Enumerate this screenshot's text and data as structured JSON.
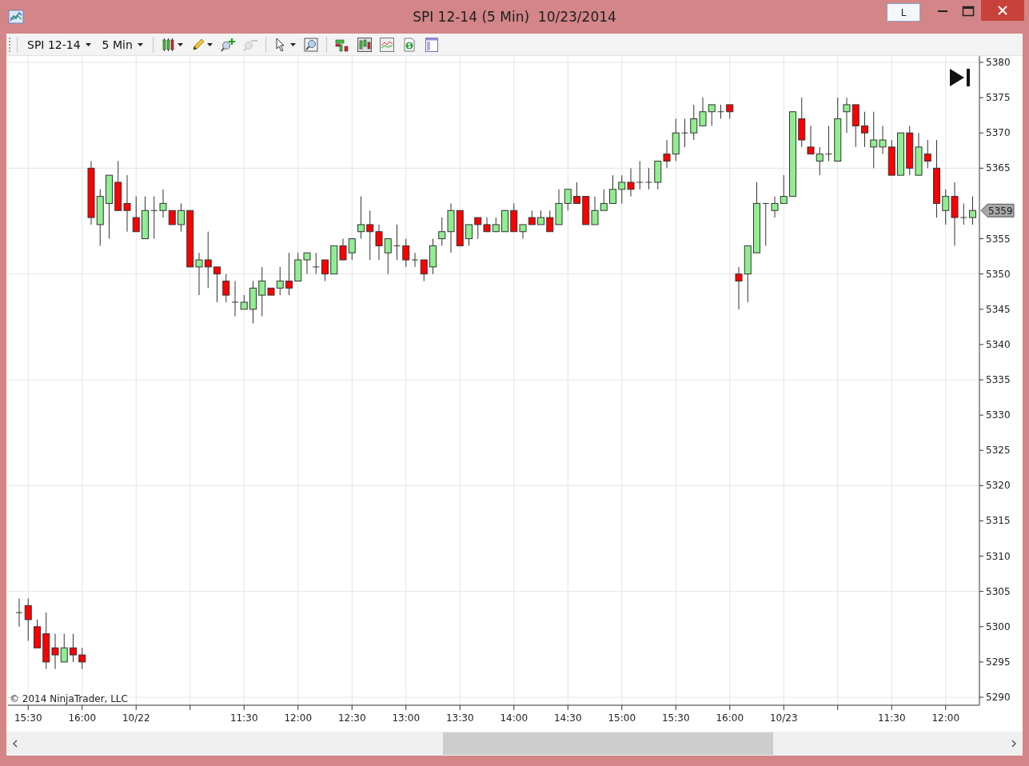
{
  "window": {
    "title": "SPI 12-14 (5 Min)  10/23/2014",
    "link_button": "L"
  },
  "toolbar": {
    "items": [
      {
        "kind": "grip"
      },
      {
        "kind": "separator"
      },
      {
        "kind": "menu",
        "label": "SPI 12-14"
      },
      {
        "kind": "menu",
        "label": "5 Min"
      },
      {
        "kind": "separator"
      },
      {
        "kind": "style",
        "dropdown": true,
        "disabled": false
      },
      {
        "kind": "draw",
        "dropdown": true,
        "disabled": false
      },
      {
        "kind": "zoomin",
        "dropdown": false,
        "disabled": false
      },
      {
        "kind": "zoomout",
        "dropdown": false,
        "disabled": true
      },
      {
        "kind": "separator"
      },
      {
        "kind": "cursor",
        "dropdown": true,
        "disabled": false
      },
      {
        "kind": "magnify",
        "dropdown": false,
        "disabled": false
      },
      {
        "kind": "separator"
      },
      {
        "kind": "indicators",
        "dropdown": false,
        "disabled": false
      },
      {
        "kind": "bars",
        "dropdown": false,
        "disabled": false
      },
      {
        "kind": "panels",
        "dropdown": false,
        "disabled": false
      },
      {
        "kind": "money",
        "dropdown": false,
        "disabled": false
      },
      {
        "kind": "properties",
        "dropdown": false,
        "disabled": false
      }
    ]
  },
  "chart": {
    "copyright": "© 2014 NinjaTrader, LLC",
    "chart_data": {
      "type": "candlestick",
      "ylim": [
        5290,
        5380
      ],
      "yticks": [
        5290,
        5295,
        5300,
        5305,
        5310,
        5315,
        5320,
        5325,
        5330,
        5335,
        5340,
        5345,
        5350,
        5355,
        5365,
        5370,
        5375,
        5380
      ],
      "categories": [
        null,
        "15:30",
        null,
        null,
        null,
        null,
        null,
        "16:00",
        null,
        null,
        null,
        null,
        null,
        "10/22",
        null,
        null,
        null,
        null,
        null,
        null,
        null,
        null,
        null,
        null,
        null,
        "11:30",
        null,
        null,
        null,
        null,
        null,
        "12:00",
        null,
        null,
        null,
        null,
        null,
        "12:30",
        null,
        null,
        null,
        null,
        null,
        "13:00",
        null,
        null,
        null,
        null,
        null,
        "13:30",
        null,
        null,
        null,
        null,
        null,
        "14:00",
        null,
        null,
        null,
        null,
        null,
        "14:30",
        null,
        null,
        null,
        null,
        null,
        "15:00",
        null,
        null,
        null,
        null,
        null,
        "15:30",
        null,
        null,
        null,
        null,
        null,
        "16:00",
        null,
        null,
        null,
        null,
        null,
        "10/23",
        null,
        null,
        null,
        null,
        null,
        null,
        null,
        null,
        null,
        null,
        null,
        "11:30",
        null,
        null,
        null,
        null,
        null,
        "12:00",
        null,
        null,
        null
      ],
      "annotations": [
        "5359"
      ],
      "grid": true,
      "ohlc": [
        [
          5302,
          5304,
          5300,
          5302
        ],
        [
          5303,
          5304,
          5298,
          5301
        ],
        [
          5300,
          5301,
          5297,
          5297
        ],
        [
          5299,
          5302,
          5294,
          5295
        ],
        [
          5297,
          5299,
          5294,
          5296
        ],
        [
          5295,
          5299,
          5295,
          5297
        ],
        [
          5297,
          5299,
          5295,
          5296
        ],
        [
          5296,
          5297,
          5294,
          5295
        ],
        [
          5365,
          5366,
          5357,
          5358
        ],
        [
          5357,
          5362,
          5354,
          5361
        ],
        [
          5360,
          5364,
          5355,
          5364
        ],
        [
          5363,
          5366,
          5359,
          5359
        ],
        [
          5360,
          5364,
          5356,
          5359
        ],
        [
          5358,
          5361,
          5356,
          5356
        ],
        [
          5355,
          5361,
          5355,
          5359
        ],
        [
          5359,
          5361,
          5355,
          5359
        ],
        [
          5359,
          5362,
          5358,
          5360
        ],
        [
          5359,
          5359,
          5357,
          5357
        ],
        [
          5357,
          5360,
          5356,
          5359
        ],
        [
          5359,
          5359,
          5351,
          5351
        ],
        [
          5351,
          5353,
          5347,
          5352
        ],
        [
          5352,
          5356,
          5348,
          5351
        ],
        [
          5351,
          5351,
          5346,
          5350
        ],
        [
          5349,
          5350,
          5346,
          5347
        ],
        [
          5346,
          5349,
          5344,
          5346
        ],
        [
          5345,
          5347,
          5345,
          5346
        ],
        [
          5345,
          5349,
          5343,
          5348
        ],
        [
          5347,
          5351,
          5344,
          5349
        ],
        [
          5348,
          5348,
          5347,
          5347
        ],
        [
          5348,
          5351,
          5347,
          5349
        ],
        [
          5349,
          5353,
          5347,
          5348
        ],
        [
          5349,
          5353,
          5349,
          5352
        ],
        [
          5352,
          5353,
          5350,
          5353
        ],
        [
          5351,
          5353,
          5350,
          5351
        ],
        [
          5352,
          5352,
          5349,
          5350
        ],
        [
          5350,
          5354,
          5350,
          5354
        ],
        [
          5354,
          5355,
          5352,
          5352
        ],
        [
          5353,
          5355,
          5352,
          5355
        ],
        [
          5356,
          5361,
          5355,
          5357
        ],
        [
          5357,
          5359,
          5352,
          5356
        ],
        [
          5356,
          5357,
          5352,
          5354
        ],
        [
          5353,
          5355,
          5350,
          5355
        ],
        [
          5354,
          5357,
          5352,
          5354
        ],
        [
          5354,
          5355,
          5351,
          5352
        ],
        [
          5352,
          5353,
          5351,
          5352
        ],
        [
          5352,
          5352,
          5349,
          5350
        ],
        [
          5351,
          5355,
          5350,
          5354
        ],
        [
          5355,
          5358,
          5354,
          5356
        ],
        [
          5356,
          5360,
          5353,
          5359
        ],
        [
          5359,
          5359,
          5354,
          5354
        ],
        [
          5355,
          5357,
          5354,
          5357
        ],
        [
          5358,
          5358,
          5355,
          5357
        ],
        [
          5357,
          5358,
          5356,
          5356
        ],
        [
          5356,
          5358,
          5356,
          5357
        ],
        [
          5356,
          5359,
          5356,
          5359
        ],
        [
          5359,
          5360,
          5356,
          5356
        ],
        [
          5356,
          5357,
          5355,
          5357
        ],
        [
          5358,
          5359,
          5357,
          5357
        ],
        [
          5357,
          5359,
          5357,
          5358
        ],
        [
          5358,
          5359,
          5356,
          5356
        ],
        [
          5357,
          5362,
          5357,
          5360
        ],
        [
          5360,
          5362,
          5359,
          5362
        ],
        [
          5361,
          5363,
          5360,
          5360
        ],
        [
          5361,
          5361,
          5357,
          5357
        ],
        [
          5357,
          5361,
          5357,
          5359
        ],
        [
          5359,
          5362,
          5359,
          5360
        ],
        [
          5360,
          5364,
          5360,
          5362
        ],
        [
          5362,
          5364,
          5360,
          5363
        ],
        [
          5363,
          5365,
          5361,
          5362
        ],
        [
          5363,
          5366,
          5362,
          5363
        ],
        [
          5363,
          5365,
          5362,
          5363
        ],
        [
          5363,
          5366,
          5362,
          5366
        ],
        [
          5367,
          5369,
          5365,
          5366
        ],
        [
          5367,
          5372,
          5366,
          5370
        ],
        [
          5370,
          5372,
          5368,
          5370
        ],
        [
          5370,
          5374,
          5369,
          5372
        ],
        [
          5371,
          5375,
          5371,
          5373
        ],
        [
          5373,
          5374,
          5371,
          5374
        ],
        [
          5373,
          5374,
          5372,
          5373
        ],
        [
          5374,
          5374,
          5372,
          5373
        ],
        [
          5350,
          5351,
          5345,
          5349
        ],
        [
          5350,
          5354,
          5346,
          5354
        ],
        [
          5353,
          5363,
          5353,
          5360
        ],
        [
          5360,
          5360,
          5354,
          5360
        ],
        [
          5359,
          5361,
          5358,
          5360
        ],
        [
          5360,
          5364,
          5360,
          5361
        ],
        [
          5361,
          5373,
          5361,
          5373
        ],
        [
          5372,
          5375,
          5368,
          5369
        ],
        [
          5368,
          5371,
          5367,
          5367
        ],
        [
          5366,
          5368,
          5364,
          5367
        ],
        [
          5367,
          5371,
          5366,
          5367
        ],
        [
          5366,
          5375,
          5366,
          5372
        ],
        [
          5373,
          5375,
          5370,
          5374
        ],
        [
          5374,
          5374,
          5368,
          5371
        ],
        [
          5371,
          5373,
          5368,
          5370
        ],
        [
          5368,
          5373,
          5365,
          5369
        ],
        [
          5368,
          5371,
          5367,
          5369
        ],
        [
          5368,
          5369,
          5364,
          5364
        ],
        [
          5364,
          5370,
          5364,
          5370
        ],
        [
          5370,
          5371,
          5364,
          5365
        ],
        [
          5364,
          5370,
          5364,
          5368
        ],
        [
          5367,
          5369,
          5365,
          5366
        ],
        [
          5365,
          5369,
          5358,
          5360
        ],
        [
          5359,
          5362,
          5357,
          5361
        ],
        [
          5361,
          5363,
          5354,
          5358
        ],
        [
          5358,
          5360,
          5357,
          5358
        ],
        [
          5358,
          5361,
          5357,
          5359
        ]
      ]
    }
  }
}
